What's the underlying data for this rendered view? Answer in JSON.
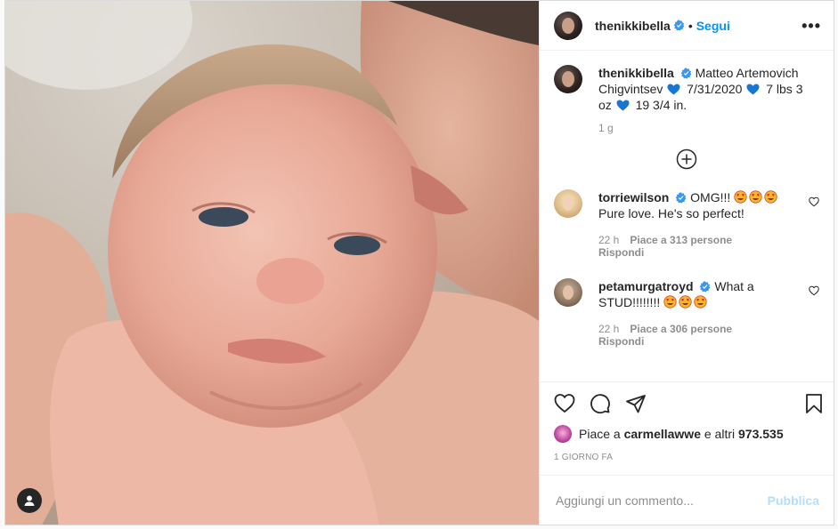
{
  "post": {
    "author": "thenikkibella",
    "follow_label": "Segui",
    "separator": "•",
    "more_label": "•••"
  },
  "caption": {
    "username": "thenikkibella",
    "part1": "Matteo Artemovich Chigvintsev",
    "part2": "7/31/2020",
    "part3": "7 lbs 3 oz",
    "part4": "19 3/4 in.",
    "time": "1 g",
    "heart_icon": "blue-heart-icon"
  },
  "comments": [
    {
      "username": "torriewilson",
      "text_before": "OMG!!!",
      "emoji_count": 3,
      "text_after": "Pure love. He's so perfect!",
      "time": "22 h",
      "likes": "Piace a 313 persone",
      "reply": "Rispondi"
    },
    {
      "username": "petamurgatroyd",
      "text_before": "What a STUD!!!!!!!!",
      "emoji_count": 3,
      "text_after": "",
      "time": "22 h",
      "likes": "Piace a 306 persone",
      "reply": "Rispondi"
    }
  ],
  "likes": {
    "prefix": "Piace a",
    "user": "carmellawwe",
    "suffix": "e altri",
    "count": "973.535"
  },
  "ago": "1 giorno fa",
  "add_comment": {
    "placeholder": "Aggiungi un commento...",
    "publish": "Pubblica"
  },
  "colors": {
    "accent": "#0095f6",
    "verified": "#3897f0",
    "publish_disabled": "#b2dffc",
    "muted": "#8e8e8e"
  }
}
